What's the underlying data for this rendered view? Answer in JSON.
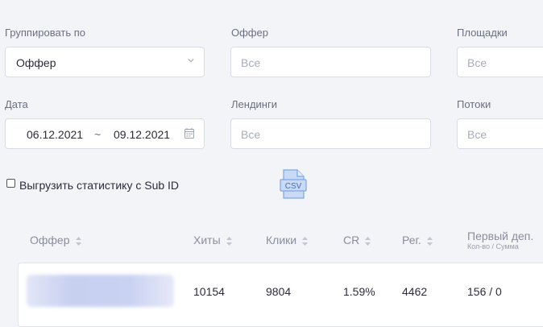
{
  "filters": {
    "group_by": {
      "label": "Группировать по",
      "value": "Оффер"
    },
    "offer": {
      "label": "Оффер",
      "placeholder": "Все"
    },
    "platforms": {
      "label": "Площадки",
      "placeholder": "Все"
    },
    "date": {
      "label": "Дата",
      "from": "06.12.2021",
      "separator": "~",
      "to": "09.12.2021"
    },
    "landings": {
      "label": "Лендинги",
      "placeholder": "Все"
    },
    "streams": {
      "label": "Потоки",
      "placeholder": "Все"
    }
  },
  "export": {
    "checkbox_label": "Выгрузить статистику с Sub ID",
    "checked": false,
    "csv_icon_text": "CSV"
  },
  "table": {
    "headers": {
      "offer": "Оффер",
      "hits": "Хиты",
      "clicks": "Клики",
      "cr": "CR",
      "reg": "Рег.",
      "first_dep": "Первый деп.",
      "first_dep_sub": "Кол-во / Сумма"
    },
    "rows": [
      {
        "hits": "10154",
        "clicks": "9804",
        "cr": "1.59%",
        "reg": "4462",
        "first_dep": "156 / 0"
      }
    ]
  },
  "colors": {
    "csv_icon": "#7da6e4",
    "background": "#f3f4f7"
  }
}
